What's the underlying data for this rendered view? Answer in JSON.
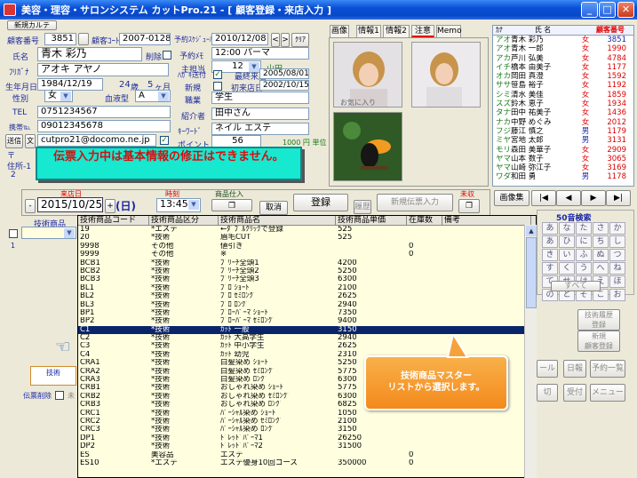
{
  "window": {
    "title": "美容・理容・サロンシステム カットPro.21 - [ 顧客登録・来店入力 ]",
    "min": "_",
    "max": "□",
    "close": "✕"
  },
  "customer": {
    "add_card": "新規カルテ",
    "number_label": "顧客番号",
    "number": "3851",
    "code_label": "顧客ｺｰﾄﾞ",
    "code": "2007-0128",
    "schedule_label": "予約ｽｹｼﾞｭｰﾙ",
    "schedule_date": "2010/12/08",
    "nav_prev": "<",
    "nav_next": ">",
    "clear": "ｸﾘｱ",
    "name_label": "氏名",
    "name": "青木 彩乃",
    "delete_label": "削除",
    "furigana_label": "ﾌﾘｶﾞﾅ",
    "furigana": "アオキ アヤノ",
    "birth_label": "生年月日",
    "birth": "1984/12/19",
    "age": "24",
    "age_unit": "歳",
    "months": "5",
    "month_unit": "ヶ月",
    "gender_label": "性別",
    "gender": "女",
    "blood_label": "血液型",
    "blood": "A",
    "tel_label": "TEL",
    "tel": "0751234567",
    "mobile_label": "携帯℡",
    "mobile": "09012345678",
    "mail_label1": "送信",
    "mail_label2": "文",
    "mail": "cutpro21@docomo.ne.jp",
    "check_mark": "✓",
    "memo_label": "予約ﾒﾓ",
    "memo": "12:00 パーマ",
    "staff_label": "主担当",
    "staff_no": "12",
    "staff_name": "山田",
    "dm_label": "ﾊｶﾞｷ送付",
    "last_visit_label": "最終来店",
    "last_visit": "2005/08/01",
    "new_label": "新規",
    "first_visit_label": "初来店日",
    "first_visit": "2002/10/15",
    "job_label": "職業",
    "job": "学生",
    "intro_label": "紹介者",
    "intro": "田中さん",
    "keyword_label": "ｷｰﾜｰﾄﾞ",
    "keyword": "ネイル エステ",
    "point_label": "ポイント",
    "point": "56",
    "point_unit": "1000 円 単位",
    "zip_label": "〒",
    "address_label": "住所-1",
    "address_num": "2"
  },
  "notice": "伝票入力中は基本情報の修正はできません。",
  "tabs": [
    "画像",
    "情報1",
    "情報2",
    "注意",
    "Memo"
  ],
  "photo_caption": "お気に入り",
  "right_list": {
    "headers": [
      "ｶﾅ",
      "氏 名",
      "",
      "顧客番号"
    ],
    "rows": [
      [
        "アオ",
        "青木 彩乃",
        "女",
        "3851"
      ],
      [
        "アオ",
        "青木 一郎",
        "女",
        "1990"
      ],
      [
        "アカ",
        "芦川 弘美",
        "女",
        "4784"
      ],
      [
        "イチ",
        "橋本 由美子",
        "女",
        "1177"
      ],
      [
        "オカ",
        "岡田 真澄",
        "女",
        "1592"
      ],
      [
        "ササ",
        "笹島 裕子",
        "女",
        "1192"
      ],
      [
        "シミ",
        "清水 美佳",
        "女",
        "1859"
      ],
      [
        "スズ",
        "鈴木 恵子",
        "女",
        "1934"
      ],
      [
        "タナ",
        "田中 祐美子",
        "女",
        "1436"
      ],
      [
        "ナカ",
        "中野 めぐみ",
        "女",
        "2012"
      ],
      [
        "フジ",
        "藤江 慎之",
        "男",
        "1179"
      ],
      [
        "ミヤ",
        "宮地 太郎",
        "男",
        "3131"
      ],
      [
        "モリ",
        "森田 美華子",
        "女",
        "2909"
      ],
      [
        "ヤマ",
        "山本 数子",
        "女",
        "3065"
      ],
      [
        "ヤマ",
        "山崎 弥江子",
        "女",
        "3169"
      ],
      [
        "ワダ",
        "和田 勇",
        "男",
        "1178"
      ]
    ]
  },
  "visit": {
    "date_label": "来店日",
    "date": "2015/10/25",
    "weekday": "(日)",
    "time_label": "時刻",
    "time": "13:45",
    "product_label": "商品仕入",
    "cancel": "取消",
    "register": "登録",
    "history": "履歴",
    "new_slip": "新規伝票入力",
    "unpaid_label": "未収",
    "image_btn": "画像集"
  },
  "tech_label": "技術商品",
  "grid": {
    "headers": [
      "技術商品コード",
      "技術商品区分",
      "技術商品名",
      "技術商品単価",
      "在庫数",
      "備考"
    ],
    "rows": [
      [
        "19",
        "*エステ",
        "←ﾀﾞﾌﾞﾙｸﾘｯｸで登録",
        "525",
        "",
        ""
      ],
      [
        "20",
        "*技術",
        "眉毛CUT",
        "525",
        "",
        ""
      ],
      [
        "9998",
        "その他",
        "値引き",
        "",
        "0",
        ""
      ],
      [
        "9999",
        "その他",
        "※",
        "",
        "0",
        ""
      ],
      [
        "BCB1",
        "*技術",
        "ﾌﾞﾘｰﾁ全頭1",
        "4200",
        "",
        ""
      ],
      [
        "BCB2",
        "*技術",
        "ﾌﾞﾘｰﾁ全頭2",
        "5250",
        "",
        ""
      ],
      [
        "BCB3",
        "*技術",
        "ﾌﾞﾘｰﾁ全頭3",
        "6300",
        "",
        ""
      ],
      [
        "BL1",
        "*技術",
        "ﾌﾞﾛ ｼｮｰﾄ",
        "2100",
        "",
        ""
      ],
      [
        "BL2",
        "*技術",
        "ﾌﾞﾛ ｾﾐﾛﾝｸﾞ",
        "2625",
        "",
        ""
      ],
      [
        "BL3",
        "*技術",
        "ﾌﾞﾛ ﾛﾝｸﾞ",
        "2940",
        "",
        ""
      ],
      [
        "BP1",
        "*技術",
        "ﾌﾞﾛｰﾊﾟｰﾏ ｼｮｰﾄ",
        "7350",
        "",
        ""
      ],
      [
        "BP2",
        "*技術",
        "ﾌﾞﾛｰﾊﾟｰﾏ ｾﾐﾛﾝｸﾞ",
        "9400",
        "",
        ""
      ],
      [
        "C1",
        "*技術",
        "ｶｯﾄ 一般",
        "3150",
        "",
        ""
      ],
      [
        "C2",
        "*技術",
        "ｶｯﾄ 大高学生",
        "2940",
        "",
        ""
      ],
      [
        "C3",
        "*技術",
        "ｶｯﾄ 中小学生",
        "2625",
        "",
        ""
      ],
      [
        "C4",
        "*技術",
        "ｶｯﾄ 幼児",
        "2310",
        "",
        ""
      ],
      [
        "CRA1",
        "*技術",
        "白髪染め ｼｮｰﾄ",
        "5250",
        "",
        ""
      ],
      [
        "CRA2",
        "*技術",
        "白髪染め ｾﾐﾛﾝｸﾞ",
        "5775",
        "",
        ""
      ],
      [
        "CRA3",
        "*技術",
        "白髪染め ﾛﾝｸﾞ",
        "6300",
        "",
        ""
      ],
      [
        "CRB1",
        "*技術",
        "おしゃれ染め ｼｮｰﾄ",
        "5775",
        "",
        ""
      ],
      [
        "CRB2",
        "*技術",
        "おしゃれ染め ｾﾐﾛﾝｸﾞ",
        "6300",
        "",
        ""
      ],
      [
        "CRB3",
        "*技術",
        "おしゃれ染め ﾛﾝｸﾞ",
        "6825",
        "",
        ""
      ],
      [
        "CRC1",
        "*技術",
        "ﾊﾟｰｼｬﾙ染め ｼｮｰﾄ",
        "1050",
        "",
        ""
      ],
      [
        "CRC2",
        "*技術",
        "ﾊﾟｰｼｬﾙ染め ｾﾐﾛﾝｸﾞ",
        "2100",
        "",
        ""
      ],
      [
        "CRC3",
        "*技術",
        "ﾊﾟｰｼｬﾙ染め ﾛﾝｸﾞ",
        "3150",
        "",
        ""
      ],
      [
        "DP1",
        "*技術",
        "ﾄﾞﾚｯﾄﾞﾊﾟｰﾏ1",
        "26250",
        "",
        ""
      ],
      [
        "DP2",
        "*技術",
        "ﾄﾞﾚｯﾄﾞﾊﾟｰﾏ2",
        "31500",
        "",
        ""
      ],
      [
        "ES",
        "美容品",
        "エステ",
        "",
        "0",
        ""
      ],
      [
        "ES10",
        "*エステ",
        "エステ優身10回コース",
        "350000",
        "0",
        ""
      ]
    ]
  },
  "callout": {
    "line1": "技術商品マスター",
    "line2": "リストから選択します。"
  },
  "kana_search": {
    "title": "50音検索",
    "keys": [
      "あ",
      "な",
      "た",
      "さ",
      "か",
      "あ",
      "ひ",
      "に",
      "ち",
      "し",
      "き",
      "い",
      "ふ",
      "ぬ",
      "つ",
      "す",
      "く",
      "う",
      "へ",
      "ね",
      "て",
      "せ",
      "け",
      "え",
      "ほ",
      "の",
      "と",
      "そ",
      "こ",
      "お"
    ],
    "all": "すべて"
  },
  "side_buttons": {
    "tech_history": "技術履歴",
    "tech_register": "登録",
    "new_customer1": "新規",
    "new_customer2": "顧客登録"
  },
  "bottom_buttons": [
    "ール",
    "日報",
    "予約一覧",
    "切",
    "受付",
    "メニュー"
  ],
  "left_bottom": {
    "tech": "技術",
    "slip_delete": "伝票削除",
    "not_done": "未"
  }
}
